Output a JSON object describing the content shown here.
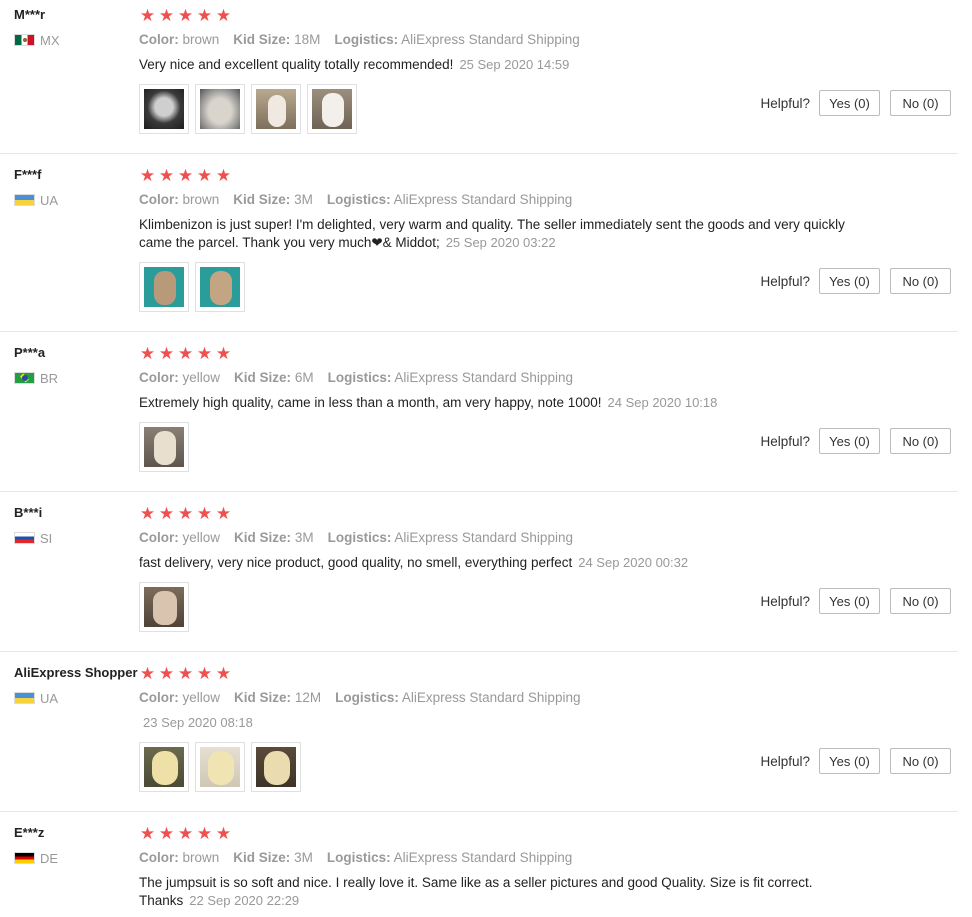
{
  "labels": {
    "color": "Color:",
    "kid_size": "Kid Size:",
    "logistics": "Logistics:",
    "helpful": "Helpful?"
  },
  "colors": {
    "star": "#f05050",
    "muted": "#999999",
    "border": "#e6e6e6"
  },
  "reviews": [
    {
      "user": "M***r",
      "country": "MX",
      "flag": "mexico-flag",
      "stars": 5,
      "color": "brown",
      "kid_size": "18M",
      "logistics": "AliExpress Standard Shipping",
      "text": "Very nice and excellent quality totally recommended!",
      "date": "25 Sep 2020 14:59",
      "photos": 4,
      "yes": "Yes (0)",
      "no": "No (0)"
    },
    {
      "user": "F***f",
      "country": "UA",
      "flag": "ukraine-flag",
      "stars": 5,
      "color": "brown",
      "kid_size": "3M",
      "logistics": "AliExpress Standard Shipping",
      "text": "Klimbenizon is just super! I'm delighted, very warm and quality. The seller immediately sent the goods and very quickly came the parcel. Thank you very much❤& Middot;",
      "date": "25 Sep 2020 03:22",
      "photos": 2,
      "yes": "Yes (0)",
      "no": "No (0)"
    },
    {
      "user": "P***a",
      "country": "BR",
      "flag": "brazil-flag",
      "stars": 5,
      "color": "yellow",
      "kid_size": "6M",
      "logistics": "AliExpress Standard Shipping",
      "text": "Extremely high quality, came in less than a month, am very happy, note 1000!",
      "date": "24 Sep 2020 10:18",
      "photos": 1,
      "yes": "Yes (0)",
      "no": "No (0)"
    },
    {
      "user": "B***i",
      "country": "SI",
      "flag": "slovenia-flag",
      "stars": 5,
      "color": "yellow",
      "kid_size": "3M",
      "logistics": "AliExpress Standard Shipping",
      "text": "fast delivery, very nice product, good quality, no smell, everything perfect",
      "date": "24 Sep 2020 00:32",
      "photos": 1,
      "yes": "Yes (0)",
      "no": "No (0)"
    },
    {
      "user": "AliExpress Shopper",
      "country": "UA",
      "flag": "ukraine-flag",
      "stars": 5,
      "color": "yellow",
      "kid_size": "12M",
      "logistics": "AliExpress Standard Shipping",
      "text": "",
      "date": "23 Sep 2020 08:18",
      "photos": 3,
      "yes": "Yes (0)",
      "no": "No (0)"
    },
    {
      "user": "E***z",
      "country": "DE",
      "flag": "germany-flag",
      "stars": 5,
      "color": "brown",
      "kid_size": "3M",
      "logistics": "AliExpress Standard Shipping",
      "text": "The jumpsuit is so soft and nice. I really love it. Same like as a seller pictures and good Quality. Size is fit correct. Thanks",
      "date": "22 Sep 2020 22:29",
      "photos": 0,
      "yes": "",
      "no": ""
    }
  ]
}
